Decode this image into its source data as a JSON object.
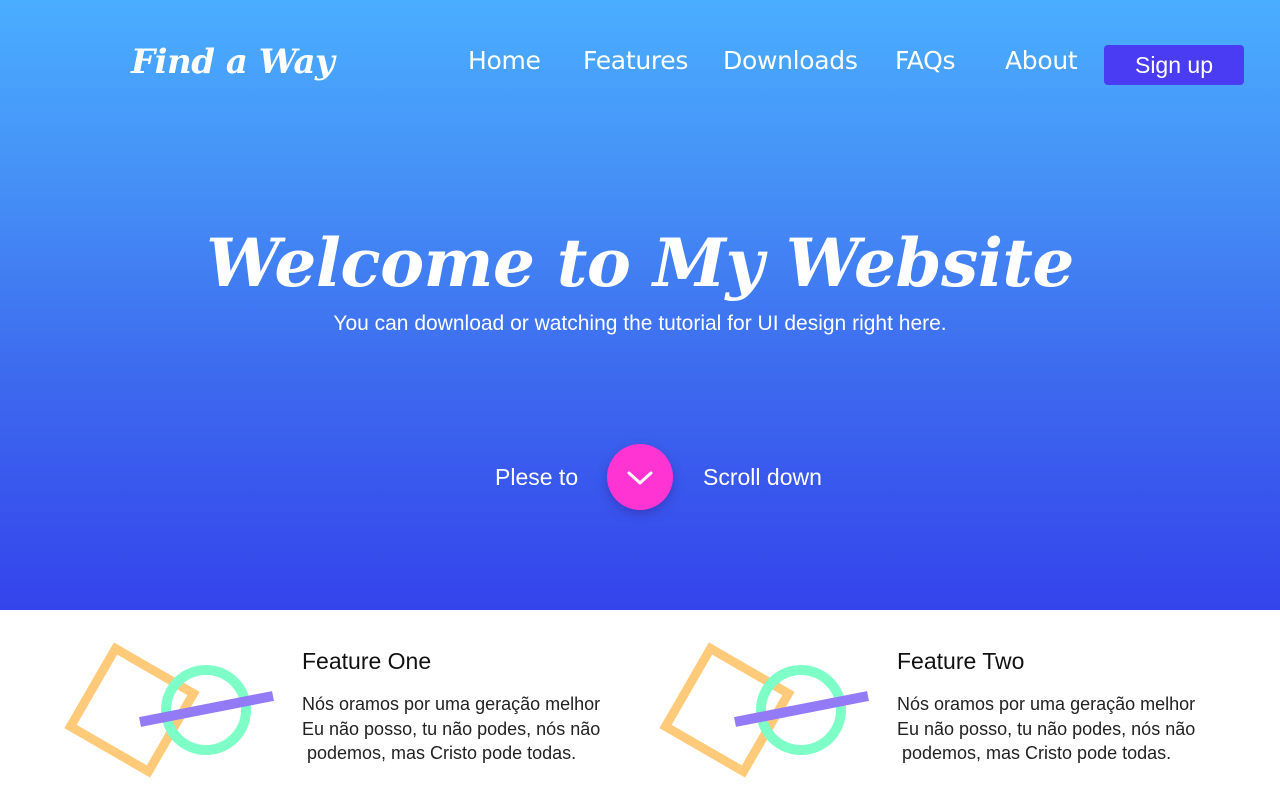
{
  "header": {
    "logo": "Find a Way",
    "nav": [
      {
        "label": "Home"
      },
      {
        "label": "Features"
      },
      {
        "label": "Downloads"
      },
      {
        "label": "FAQs"
      },
      {
        "label": "About"
      }
    ],
    "signup_label": "Sign up"
  },
  "hero": {
    "title": "Welcome to My Website",
    "subtitle": "You can download or watching the tutorial for UI design right here.",
    "scroll_left": "Plese to",
    "scroll_right": "Scroll down"
  },
  "features": [
    {
      "title": "Feature One",
      "text": "Nós oramos por uma geração melhor\nEu não posso, tu não podes, nós não\n podemos, mas Cristo pode todas."
    },
    {
      "title": "Feature Two",
      "text": "Nós oramos por uma geração melhor\nEu não posso, tu não podes, nós não\n podemos, mas Cristo pode todas."
    }
  ],
  "icons": {
    "scroll_button": "chevron-down-icon",
    "feature_art": "geometric-shapes-icon"
  },
  "colors": {
    "gradient_top": "#4aaeff",
    "gradient_bottom": "#3444ec",
    "signup_bg": "#4a3cf2",
    "scroll_button": "#ff34d2",
    "square_outline": "#ffcb7a",
    "circle_outline": "#7dffc7",
    "bar": "#937bf7"
  }
}
